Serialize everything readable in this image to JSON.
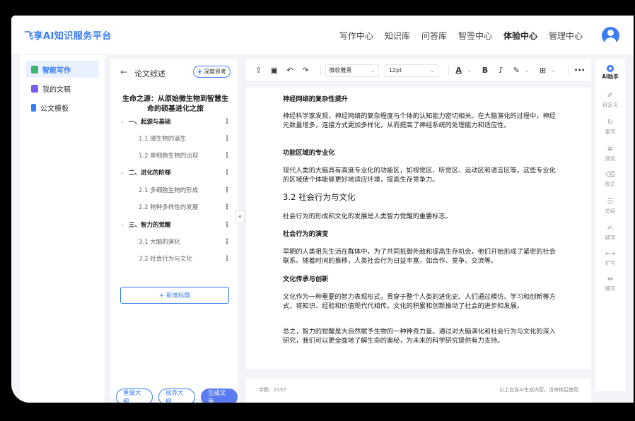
{
  "app": {
    "brand": "飞享AI知识服务平台",
    "colors": {
      "accent": "#3a7df6",
      "primary_button": "#5b7cf0",
      "background": "#f2f4f7"
    }
  },
  "header": {
    "nav": [
      {
        "label": "写作中心",
        "active": false
      },
      {
        "label": "知识库",
        "active": false
      },
      {
        "label": "问答库",
        "active": false
      },
      {
        "label": "智签中心",
        "active": false
      },
      {
        "label": "体验中心",
        "active": true
      },
      {
        "label": "管理中心",
        "active": false
      }
    ],
    "avatar_icon": "user-avatar-icon"
  },
  "sidebar": {
    "items": [
      {
        "label": "智能写作",
        "icon": "smart-writing-icon",
        "color": "#3bb46e",
        "active": true
      },
      {
        "label": "我的文稿",
        "icon": "my-drafts-icon",
        "color": "#7b5cf0",
        "active": false
      },
      {
        "label": "公文模板",
        "icon": "template-icon",
        "color": "#3a7df6",
        "active": false
      }
    ]
  },
  "outline": {
    "back_icon": "←",
    "title": "论文综述",
    "deep_think": "深度思考",
    "doc_title": "生命之源：从原始微生物到智慧生命的硕基进化之旅",
    "sections": [
      {
        "label": "一、起源与基础",
        "subs": [
          "1.1 微生物的诞生",
          "1.2 单细胞生物的出现"
        ]
      },
      {
        "label": "二、进化的阶梯",
        "subs": [
          "2.1 多细胞生物的形成",
          "2.2 物种多样性的发展"
        ]
      },
      {
        "label": "三、智力的觉醒",
        "subs": [
          "3.1 大脑的演化",
          "3.2 社会行为与文化"
        ]
      }
    ],
    "add_heading": "+ 新增标题",
    "buttons": {
      "redo": "重做大纲",
      "discard": "放弃大纲",
      "generate": "生成文章"
    },
    "collapse_icon": "«"
  },
  "toolbar": {
    "font_family": "微软雅黑",
    "font_size": "12pt",
    "icons": [
      "share-icon",
      "save-icon",
      "undo-icon",
      "redo-icon"
    ],
    "more": "•••"
  },
  "content": {
    "paragraphs": [
      {
        "type": "h",
        "text": "神经网络的复杂性提升"
      },
      {
        "type": "p",
        "text": "神经科学家发现，神经网络的复杂程度与个体的认知能力密切相关。在大脑演化的过程中，神经元数量增多，连接方式更加多样化，从而提高了神经系统的处理能力和适应性。"
      },
      {
        "type": "h",
        "text": "功能区域的专业化"
      },
      {
        "type": "p",
        "text": "现代人类的大脑具有高度专业化的功能区，如视觉区、听觉区、运动区和语言区等。这些专业化的区域使个体能够更好地适应环境，提高生存竞争力。"
      },
      {
        "type": "h2",
        "text": "3.2 社会行为与文化"
      },
      {
        "type": "p",
        "text": "社会行为的形成和文化的发展是人类智力觉醒的重要标志。"
      },
      {
        "type": "h",
        "text": "社会行为的演变"
      },
      {
        "type": "p",
        "text": "早期的人类祖先生活在群体中，为了共同抵御外敌和提高生存机会，他们开始形成了紧密的社会联系。随着时间的推移，人类社会行为日益丰富，如合作、竞争、交流等。"
      },
      {
        "type": "h",
        "text": "文化传承与创新"
      },
      {
        "type": "p",
        "text": "文化作为一种重要的智力表现形式，贯穿于整个人类的进化史。人们通过模仿、学习和创新等方式，将知识、经验和价值观代代相传。文化的积累和创新推动了社会的进步和发展。"
      },
      {
        "type": "p",
        "text": "总之，智力的觉醒是大自然赋予生物的一种神奇力量。通过对大脑演化和社会行为与文化的深入研究，我们可以更全面地了解生命的奥秘，为未来的科学研究提供有力支持。"
      }
    ]
  },
  "status": {
    "word_count": "字数：2157",
    "notice": "以上包含AI生成内容，请审核后使用"
  },
  "rightbar": {
    "items": [
      {
        "label": "AI助手",
        "icon": "ai-assistant-icon",
        "active": true
      },
      {
        "label": "自定义",
        "icon": "customize-icon"
      },
      {
        "label": "重写",
        "icon": "rewrite-icon"
      },
      {
        "label": "润色",
        "icon": "polish-icon"
      },
      {
        "label": "校正",
        "icon": "proofread-icon"
      },
      {
        "label": "总结",
        "icon": "summary-icon"
      },
      {
        "label": "续写",
        "icon": "continue-icon"
      },
      {
        "label": "扩写",
        "icon": "expand-icon"
      },
      {
        "label": "缩写",
        "icon": "shorten-icon"
      }
    ]
  }
}
